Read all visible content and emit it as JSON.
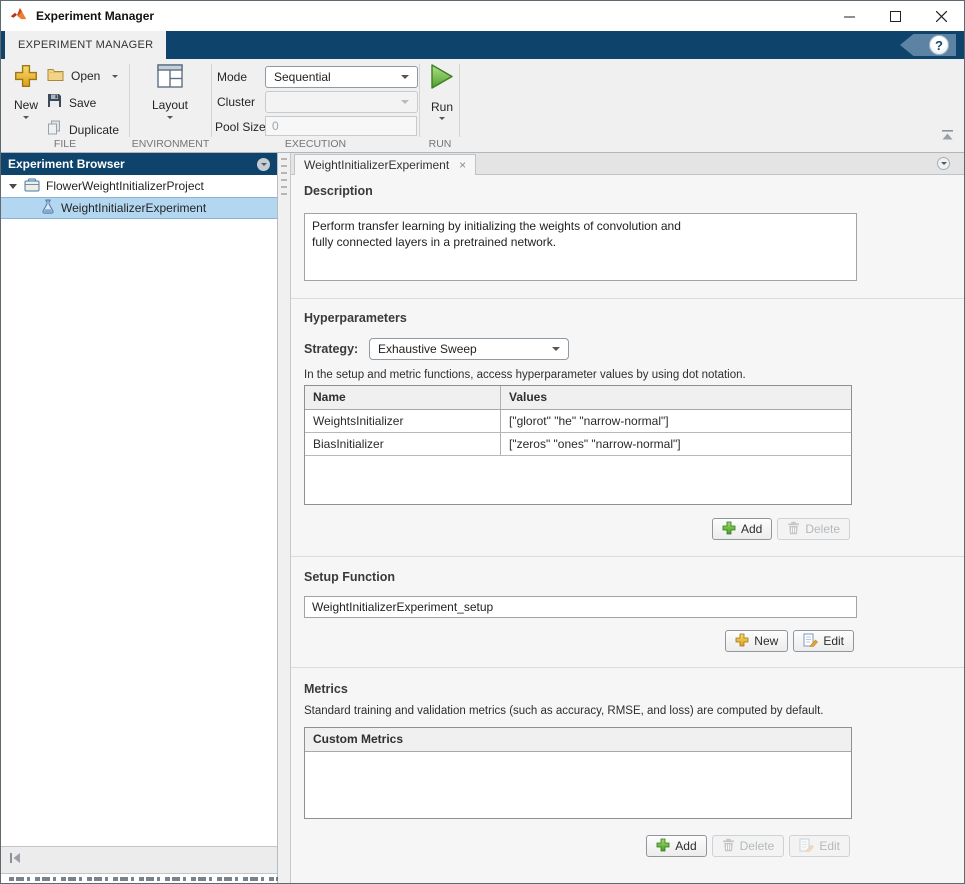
{
  "window": {
    "title": "Experiment Manager"
  },
  "ribbon": {
    "tab_label": "EXPERIMENT MANAGER",
    "file": {
      "section_label": "FILE",
      "new_label": "New",
      "open_label": "Open",
      "save_label": "Save",
      "duplicate_label": "Duplicate"
    },
    "environment": {
      "section_label": "ENVIRONMENT",
      "layout_label": "Layout"
    },
    "execution": {
      "section_label": "EXECUTION",
      "mode_label": "Mode",
      "mode_value": "Sequential",
      "cluster_label": "Cluster",
      "cluster_value": "",
      "pool_size_label": "Pool Size",
      "pool_size_value": "0"
    },
    "run": {
      "section_label": "RUN",
      "run_label": "Run"
    },
    "help_glyph": "?"
  },
  "browser": {
    "title": "Experiment Browser",
    "project_name": "FlowerWeightInitializerProject",
    "experiment_name": "WeightInitializerExperiment"
  },
  "doc": {
    "tab_label": "WeightInitializerExperiment",
    "tab_close": "×",
    "description": {
      "heading": "Description",
      "text": "Perform transfer learning by initializing the weights of convolution and\nfully connected layers in a pretrained network."
    },
    "hyperparameters": {
      "heading": "Hyperparameters",
      "strategy_label": "Strategy:",
      "strategy_value": "Exhaustive Sweep",
      "hint": "In the setup and metric functions, access hyperparameter values by using dot notation.",
      "table": {
        "headers": [
          "Name",
          "Values"
        ],
        "rows": [
          [
            "WeightsInitializer",
            "[\"glorot\" \"he\" \"narrow-normal\"]"
          ],
          [
            "BiasInitializer",
            "[\"zeros\" \"ones\" \"narrow-normal\"]"
          ]
        ]
      },
      "add_label": "Add",
      "delete_label": "Delete"
    },
    "setup_function": {
      "heading": "Setup Function",
      "value": "WeightInitializerExperiment_setup",
      "new_label": "New",
      "edit_label": "Edit"
    },
    "metrics": {
      "heading": "Metrics",
      "hint": "Standard training and validation metrics (such as accuracy, RMSE, and loss) are computed by default.",
      "table_header": "Custom Metrics",
      "add_label": "Add",
      "delete_label": "Delete",
      "edit_label": "Edit"
    }
  },
  "colors": {
    "ribbon_navy": "#0e436b",
    "help_badge_blue": "#5d83a4",
    "selection_blue": "#b3d7f0",
    "run_green": "#5ca83a",
    "add_green": "#55a82e",
    "plus_gold": "#e8b01f"
  }
}
